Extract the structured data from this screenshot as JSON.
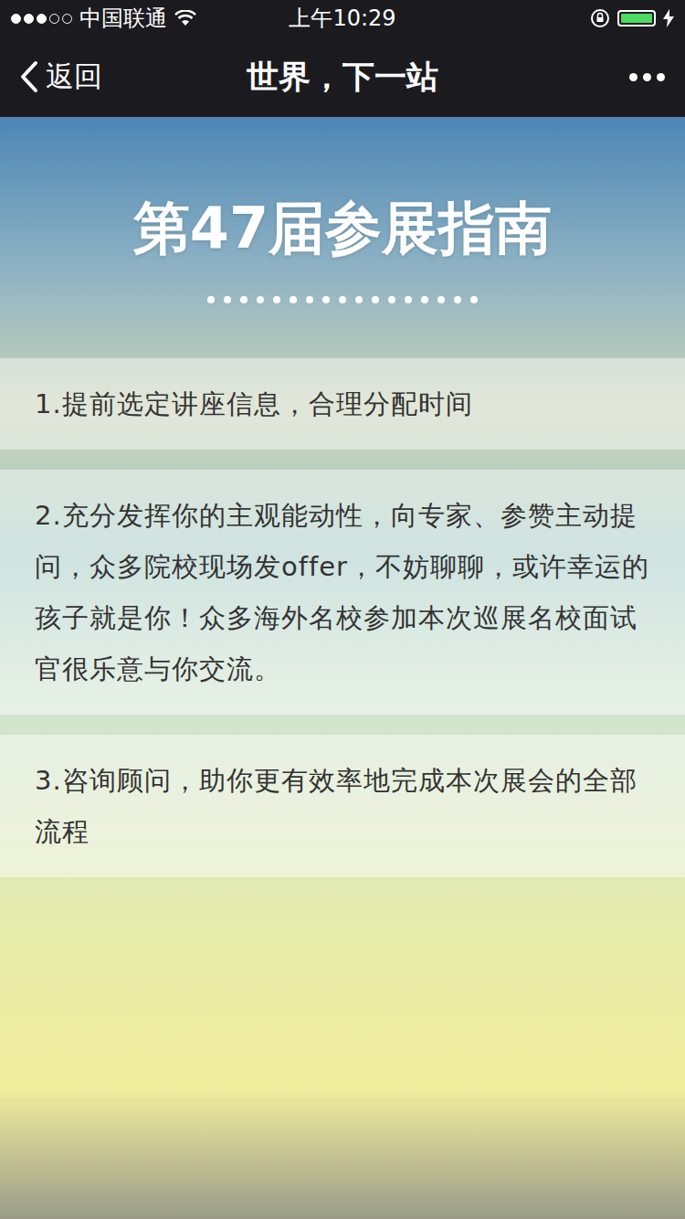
{
  "status_bar": {
    "signal_bars": 3,
    "signal_total": 5,
    "carrier": "中国联通",
    "time": "上午10:29",
    "battery": {
      "level": 1.0,
      "charging": true
    },
    "orientation_lock": true
  },
  "nav_bar": {
    "back": "返回",
    "title": "世界，下一站"
  },
  "hero": {
    "title": "第47届参展指南",
    "dots": 17
  },
  "tips": [
    {
      "text": "1.提前选定讲座信息，合理分配时间"
    },
    {
      "text": "2.充分发挥你的主观能动性，向专家、参赞主动提问，众多院校现场发offer，不妨聊聊，或许幸运的孩子就是你！众多海外名校参加本次巡展名校面试官很乐意与你交流。"
    },
    {
      "text": "3.咨询顾问，助你更有效率地完成本次展会的全部流程"
    }
  ]
}
